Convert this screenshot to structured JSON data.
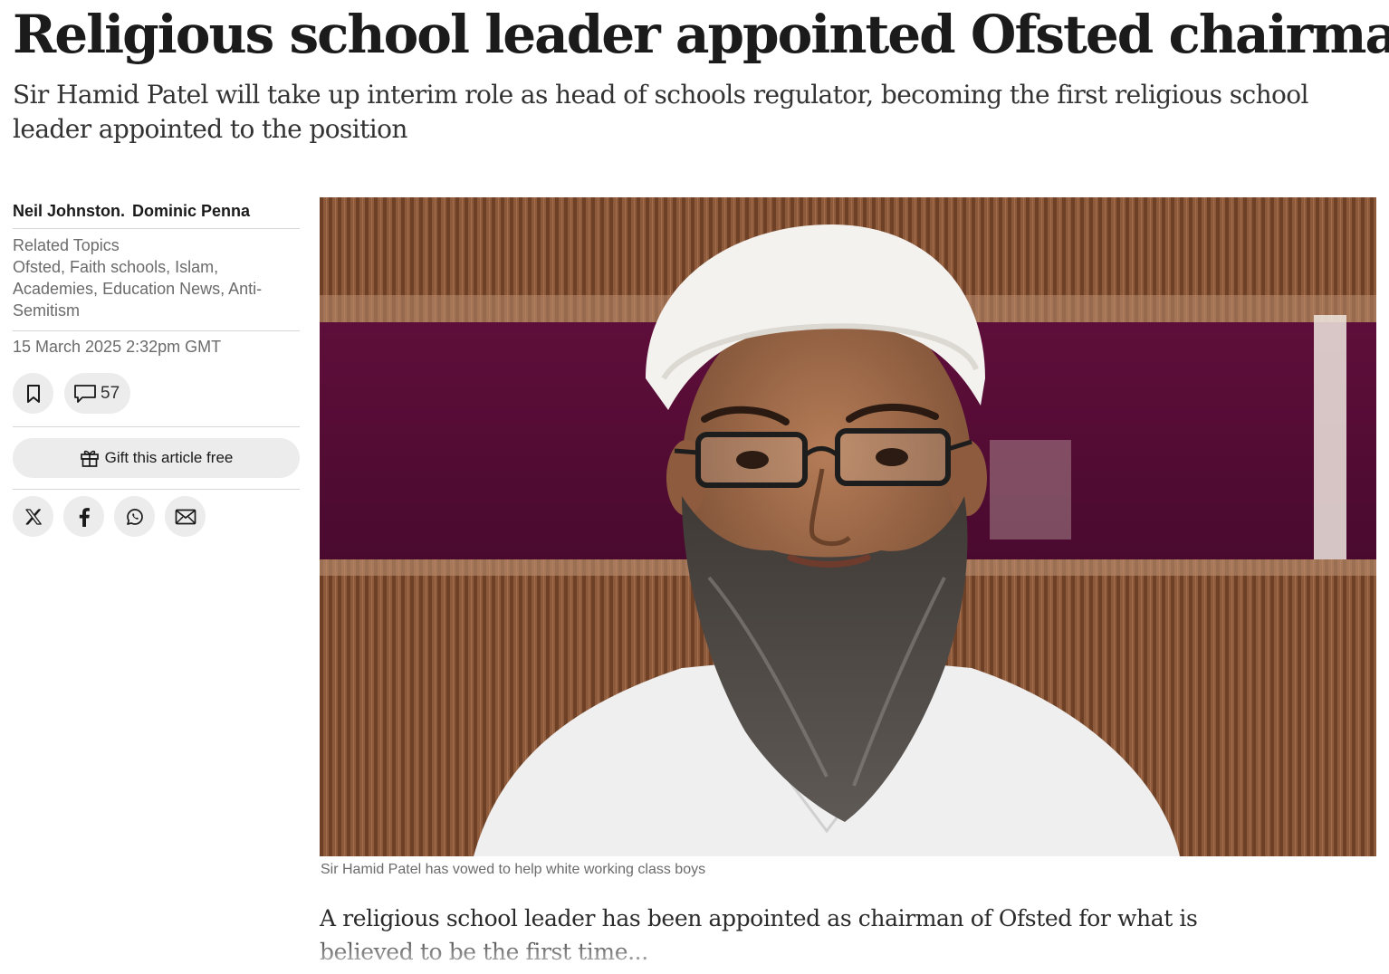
{
  "article": {
    "headline": "Religious school leader appointed Ofsted chairman",
    "standfirst": "Sir Hamid Patel will take up interim role as head of schools regulator, becoming the first religious school leader appointed to the position",
    "authors": [
      "Neil Johnston.",
      "Dominic Penna"
    ],
    "related_topics_heading": "Related Topics",
    "topics": [
      "Ofsted",
      "Faith schools",
      "Islam",
      "Academies",
      "Education News",
      "Anti-Semitism"
    ],
    "timestamp": "15 March 2025 2:32pm GMT",
    "comment_count": "57",
    "gift_label": "Gift this article free",
    "photo_caption": "Sir Hamid Patel has vowed to help white working class boys",
    "intro": "A religious school leader has been appointed as chairman of Ofsted for what is believed to be the first time..."
  },
  "icons": {
    "bookmark": "bookmark-icon",
    "comment": "comment-icon",
    "gift": "gift-icon",
    "x": "x-icon",
    "facebook": "facebook-icon",
    "whatsapp": "whatsapp-icon",
    "email": "email-icon"
  },
  "colors": {
    "pill_background": "#ececec",
    "meta_text": "#6b6b6b",
    "divider": "#d6d6d6"
  }
}
